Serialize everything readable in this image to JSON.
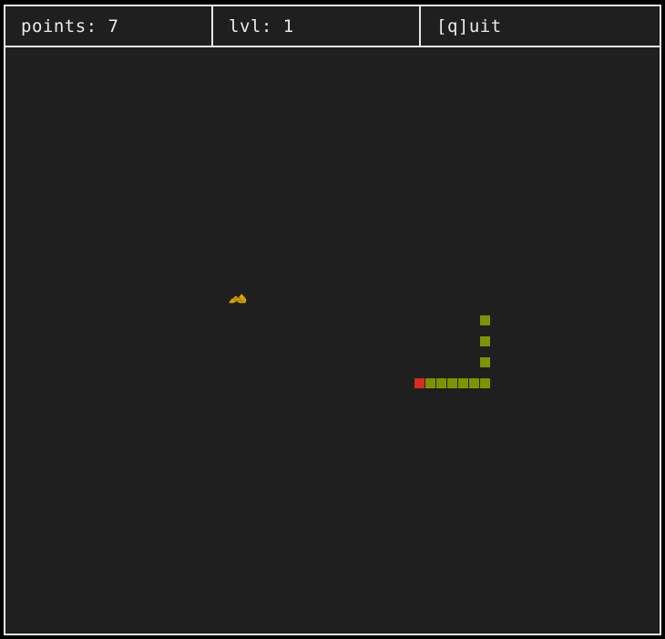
{
  "header": {
    "points_label": "points: 7",
    "level_label": "lvl: 1",
    "quit_label": "[q]uit"
  },
  "game": {
    "colors": {
      "background": "#1f1f1f",
      "border": "#e8e8e8",
      "snake_body": "#7d9400",
      "snake_head": "#d62d20",
      "food": "#d4a000"
    },
    "food_icon": "food-icon",
    "snake_length": 10
  }
}
